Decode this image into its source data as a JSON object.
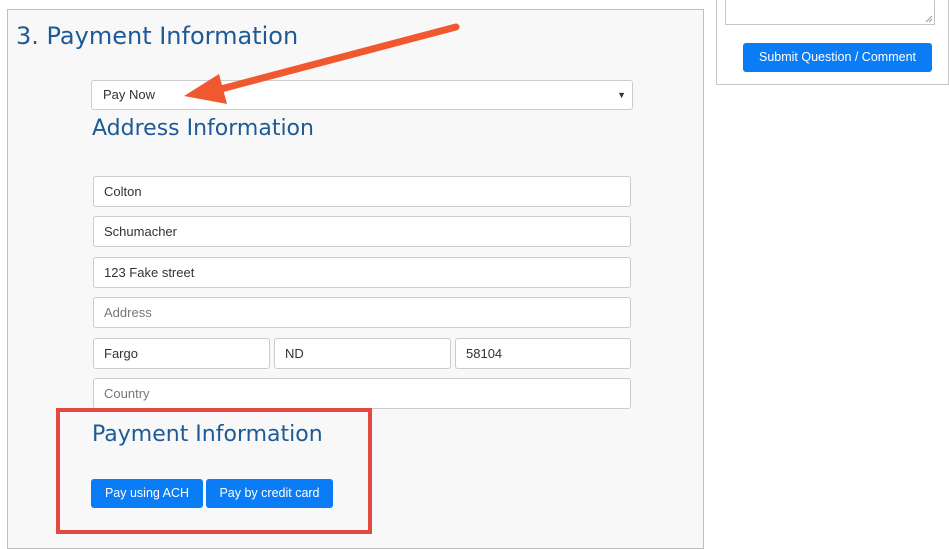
{
  "section": {
    "title": "3. Payment Information"
  },
  "payment_option": {
    "selected": "Pay Now"
  },
  "address": {
    "title": "Address Information",
    "first_name": "Colton",
    "last_name": "Schumacher",
    "address1": "123 Fake street",
    "address2_placeholder": "Address",
    "city": "Fargo",
    "state": "ND",
    "zip": "58104",
    "country_placeholder": "Country"
  },
  "payment": {
    "title": "Payment Information",
    "ach_button": "Pay using ACH",
    "card_button": "Pay by credit card"
  },
  "sidebar": {
    "submit_button": "Submit Question / Comment"
  },
  "annotations": {
    "arrow_color": "#f0582f",
    "box_color": "#e3493e",
    "accent": "#0a7cf5",
    "heading_color": "#1e5a96"
  }
}
